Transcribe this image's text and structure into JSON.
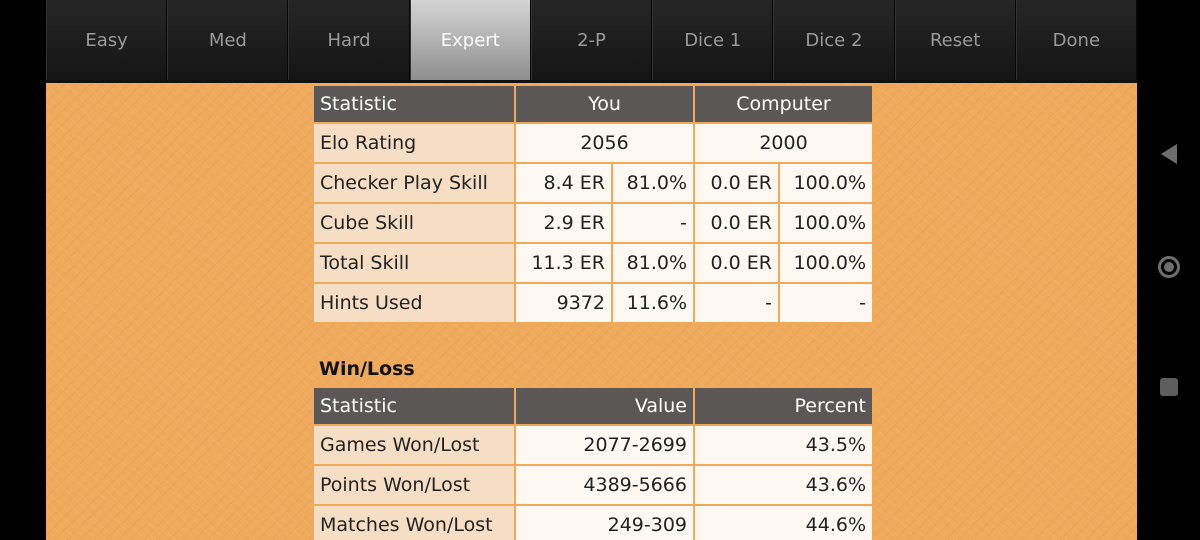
{
  "tabs": [
    {
      "label": "Easy",
      "active": false
    },
    {
      "label": "Med",
      "active": false
    },
    {
      "label": "Hard",
      "active": false
    },
    {
      "label": "Expert",
      "active": true
    },
    {
      "label": "2-P",
      "active": false
    },
    {
      "label": "Dice 1",
      "active": false
    },
    {
      "label": "Dice 2",
      "active": false
    },
    {
      "label": "Reset",
      "active": false
    },
    {
      "label": "Done",
      "active": false
    }
  ],
  "skill_table": {
    "headers": {
      "statistic": "Statistic",
      "you": "You",
      "computer": "Computer"
    },
    "elo": {
      "label": "Elo Rating",
      "you": "2056",
      "computer": "2000"
    },
    "rows": [
      {
        "label": "Checker Play Skill",
        "you_a": "8.4 ER",
        "you_b": "81.0%",
        "comp_a": "0.0 ER",
        "comp_b": "100.0%"
      },
      {
        "label": "Cube Skill",
        "you_a": "2.9 ER",
        "you_b": "-",
        "comp_a": "0.0 ER",
        "comp_b": "100.0%"
      },
      {
        "label": "Total Skill",
        "you_a": "11.3 ER",
        "you_b": "81.0%",
        "comp_a": "0.0 ER",
        "comp_b": "100.0%"
      },
      {
        "label": "Hints Used",
        "you_a": "9372",
        "you_b": "11.6%",
        "comp_a": "-",
        "comp_b": "-"
      }
    ]
  },
  "winloss": {
    "heading": "Win/Loss",
    "headers": {
      "statistic": "Statistic",
      "value": "Value",
      "percent": "Percent"
    },
    "rows": [
      {
        "label": "Games Won/Lost",
        "value": "2077-2699",
        "percent": "43.5%"
      },
      {
        "label": "Points Won/Lost",
        "value": "4389-5666",
        "percent": "43.6%"
      },
      {
        "label": "Matches Won/Lost",
        "value": "249-309",
        "percent": "44.6%"
      }
    ]
  },
  "nav_icons": [
    "back-icon",
    "home-icon",
    "recent-apps-icon"
  ]
}
